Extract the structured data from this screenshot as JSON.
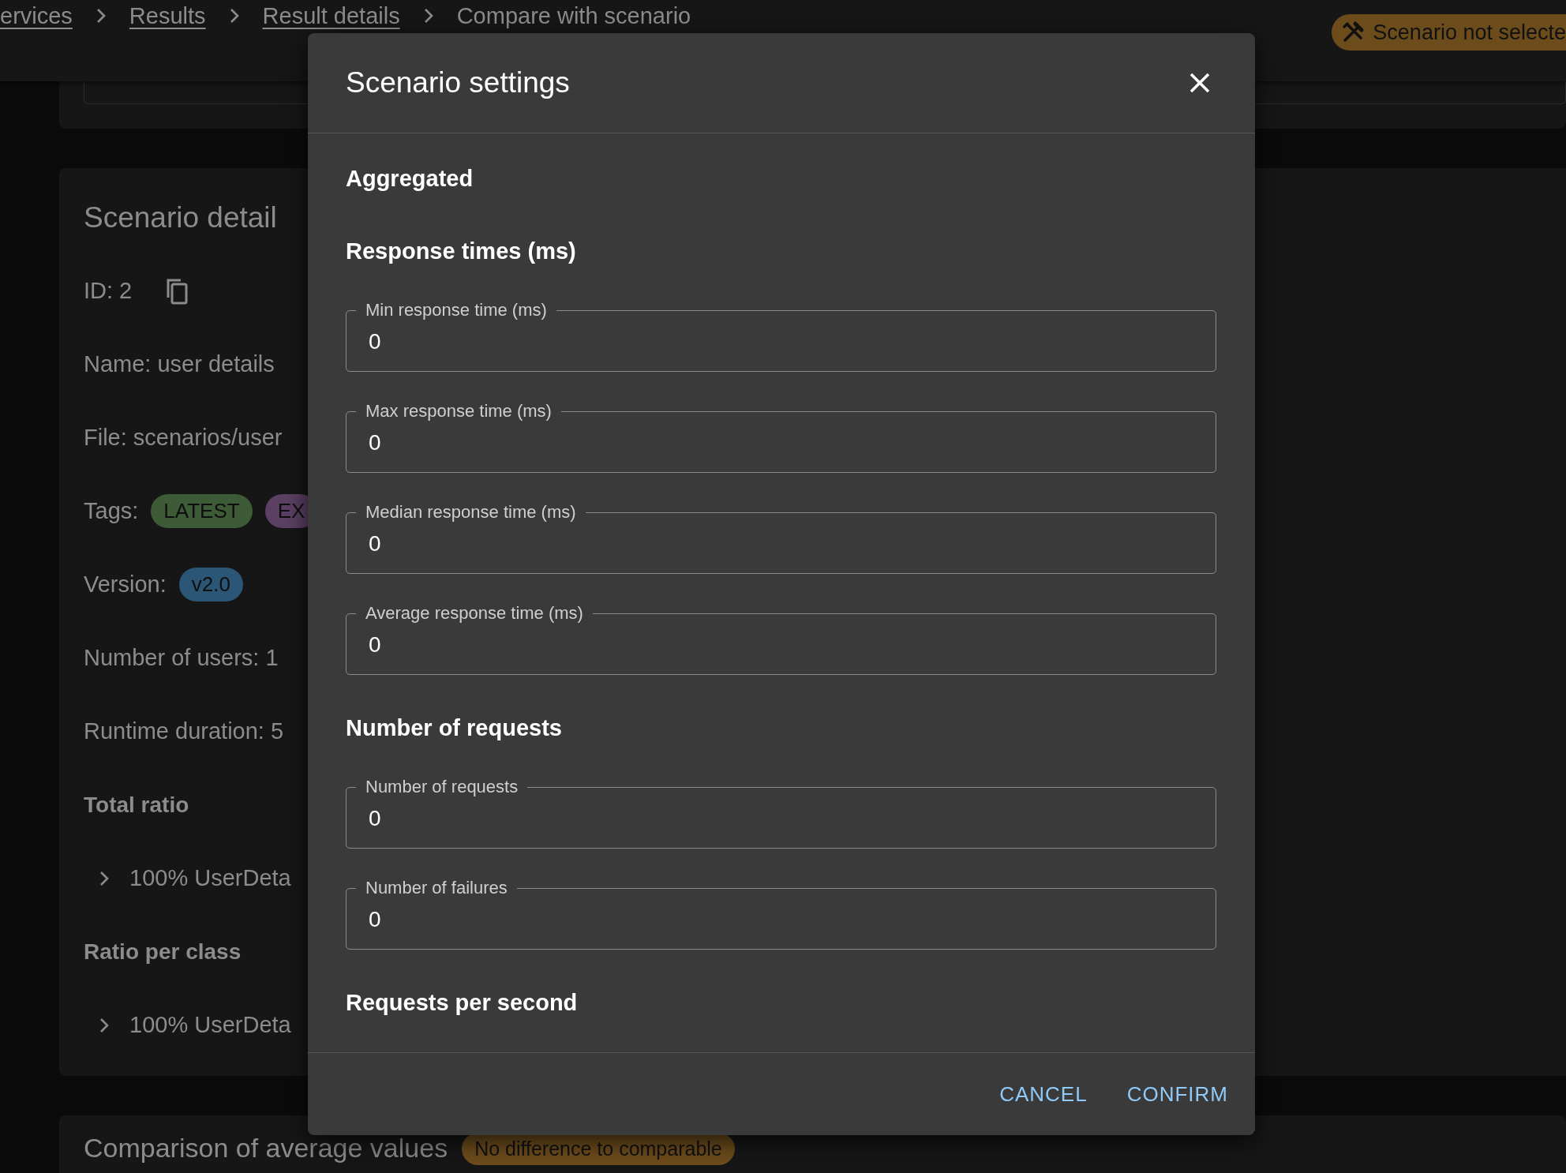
{
  "breadcrumbs": [
    {
      "label": "ervices",
      "current": false
    },
    {
      "label": "Results",
      "current": false
    },
    {
      "label": "Result details",
      "current": false
    },
    {
      "label": "Compare with scenario",
      "current": true
    }
  ],
  "status_badge": {
    "label": "Scenario not selecte"
  },
  "scenario_details": {
    "title": "Scenario detail",
    "id": "ID: 2",
    "name": "Name: user details",
    "file": "File: scenarios/user",
    "tags": {
      "label": "Tags:",
      "items": [
        {
          "label": "LATEST",
          "color": "#3e5b37"
        },
        {
          "label": "EX",
          "color": "#5b4063"
        }
      ]
    },
    "version": {
      "label": "Version:",
      "value": "v2.0"
    },
    "users": "Number of users: 1",
    "runtime": "Runtime duration: 5",
    "sections": [
      {
        "title": "Total ratio",
        "items": [
          {
            "label": "100% UserDeta",
            "expanded": false
          }
        ]
      },
      {
        "title": "Ratio per class",
        "items": [
          {
            "label": "100% UserDeta",
            "expanded": false
          }
        ]
      }
    ]
  },
  "comparison": {
    "title": "Comparison of average values",
    "badge": "No difference to comparable"
  },
  "dialog": {
    "title": "Scenario settings",
    "body": [
      {
        "kind": "heading",
        "text": "Aggregated"
      },
      {
        "kind": "heading",
        "text": "Response times (ms)"
      },
      {
        "kind": "field",
        "label": "Min response time (ms)",
        "value": "0"
      },
      {
        "kind": "field",
        "label": "Max response time (ms)",
        "value": "0"
      },
      {
        "kind": "field",
        "label": "Median response time (ms)",
        "value": "0"
      },
      {
        "kind": "field",
        "label": "Average response time (ms)",
        "value": "0"
      },
      {
        "kind": "heading",
        "text": "Number of requests"
      },
      {
        "kind": "field",
        "label": "Number of requests",
        "value": "0"
      },
      {
        "kind": "field",
        "label": "Number of failures",
        "value": "0"
      },
      {
        "kind": "heading",
        "text": "Requests per second"
      }
    ],
    "buttons": [
      "CANCEL",
      "CONFIRM"
    ]
  }
}
